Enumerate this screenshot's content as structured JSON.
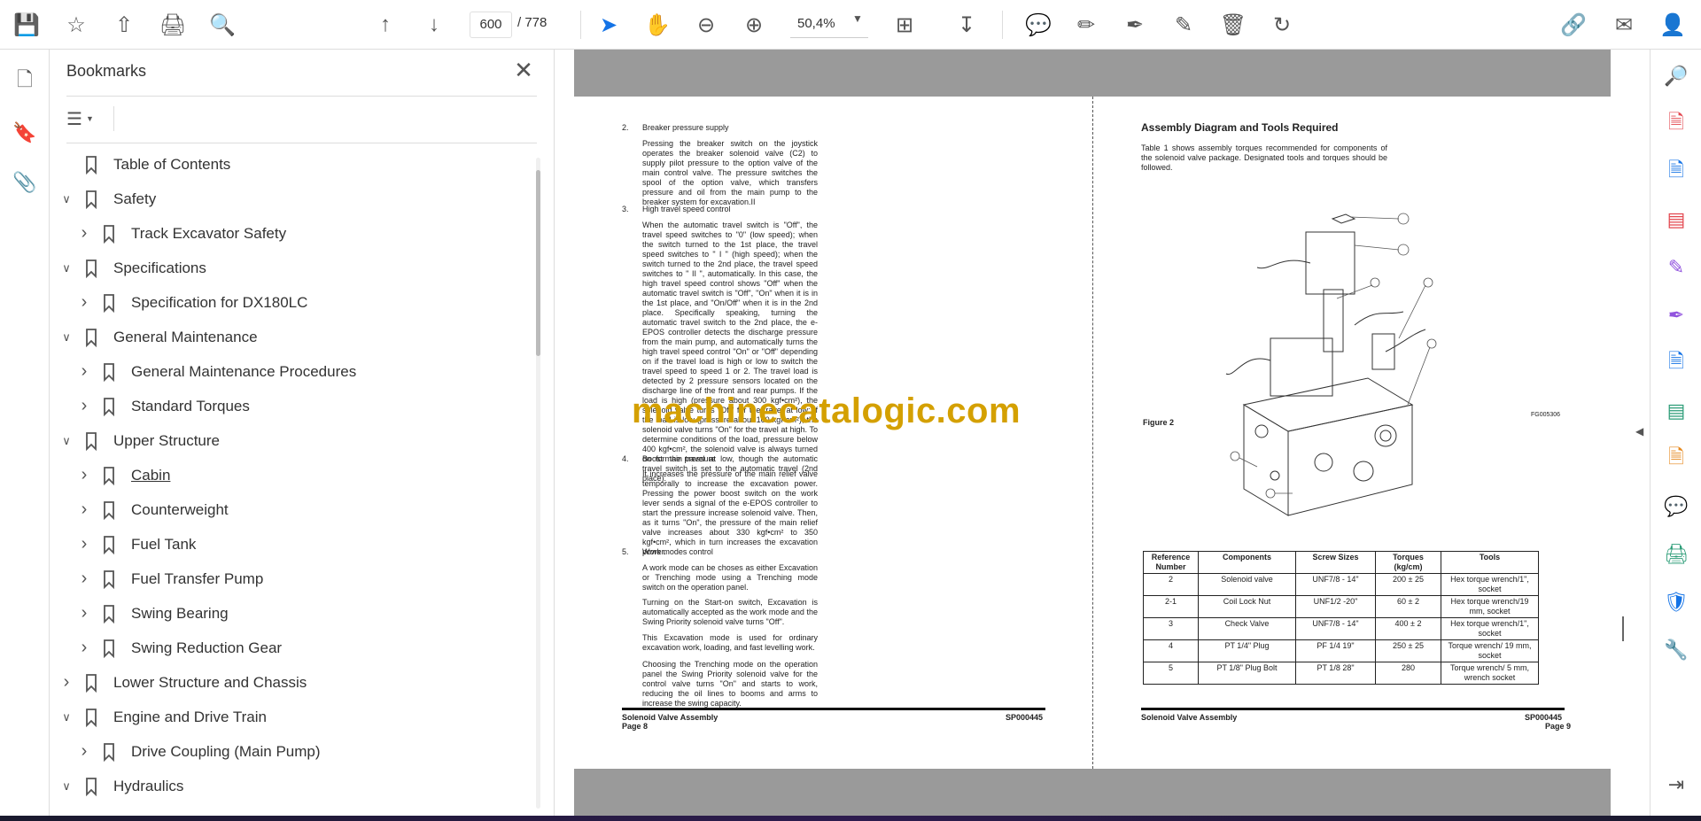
{
  "toolbar": {
    "page_current": "600",
    "page_total": "/ 778",
    "zoom": "50,4%",
    "icons": [
      "save-icon",
      "star-icon",
      "upload-icon",
      "print-icon",
      "find-icon",
      "page-up-icon",
      "page-down-icon",
      "select-arrow-icon",
      "hand-icon",
      "zoom-out-icon",
      "zoom-in-icon",
      "fit-page-icon",
      "scroll-mode-icon",
      "comment-icon",
      "highlight-icon",
      "sign-icon",
      "edit-icon",
      "delete-icon",
      "rotate-icon",
      "share-link-icon",
      "mail-icon",
      "account-icon"
    ]
  },
  "bookmarks": {
    "title": "Bookmarks",
    "items": [
      {
        "label": "Table of Contents",
        "level": 0,
        "chevron": "none"
      },
      {
        "label": "Safety",
        "level": 0,
        "chevron": "down"
      },
      {
        "label": "Track Excavator Safety",
        "level": 1,
        "chevron": "right"
      },
      {
        "label": "Specifications",
        "level": 0,
        "chevron": "down"
      },
      {
        "label": "Specification for DX180LC",
        "level": 1,
        "chevron": "right"
      },
      {
        "label": "General Maintenance",
        "level": 0,
        "chevron": "down"
      },
      {
        "label": "General Maintenance Procedures",
        "level": 1,
        "chevron": "right"
      },
      {
        "label": "Standard Torques",
        "level": 1,
        "chevron": "right"
      },
      {
        "label": "Upper Structure",
        "level": 0,
        "chevron": "down"
      },
      {
        "label": "Cabin",
        "level": 1,
        "chevron": "right"
      },
      {
        "label": "Counterweight",
        "level": 1,
        "chevron": "right"
      },
      {
        "label": "Fuel Tank",
        "level": 1,
        "chevron": "right"
      },
      {
        "label": "Fuel Transfer Pump",
        "level": 1,
        "chevron": "right"
      },
      {
        "label": "Swing Bearing",
        "level": 1,
        "chevron": "right"
      },
      {
        "label": "Swing Reduction Gear",
        "level": 1,
        "chevron": "right"
      },
      {
        "label": "Lower Structure and Chassis",
        "level": 0,
        "chevron": "right"
      },
      {
        "label": "Engine and Drive Train",
        "level": 0,
        "chevron": "down"
      },
      {
        "label": "Drive Coupling (Main Pump)",
        "level": 1,
        "chevron": "right"
      },
      {
        "label": "Hydraulics",
        "level": 0,
        "chevron": "down"
      }
    ]
  },
  "left_page": {
    "s2_num": "2.",
    "s2_title": "Breaker pressure supply",
    "s2_body": "Pressing the breaker switch on the joystick operates the breaker solenoid valve (C2) to supply pilot pressure to the option valve of the main control valve. The pressure switches the spool of the option valve, which transfers pressure and oil from the main pump to the breaker system for excavation.II",
    "s3_num": "3.",
    "s3_title": "High travel speed control",
    "s3_body": "When the automatic travel switch is \"Off\", the travel speed switches to \"0\" (low speed); when the switch turned to the 1st place, the travel speed switches to \" I \" (high speed); when the switch turned to the 2nd place, the travel speed switches to \" II \", automatically. In this case, the high travel speed control shows \"Off\" when the automatic travel switch is \"Off\", \"On\" when it is in the 1st place, and \"On/Off\" when it is in the 2nd place. Specifically speaking, turning the automatic travel switch to the 2nd place, the e-EPOS controller detects the discharge pressure from the main pump, and automatically turns the high travel speed control \"On\" or \"Off\" depending on if the travel load is high or low to switch the travel speed to speed 1 or 2. The travel load is detected by 2 pressure sensors located on the discharge line of the front and rear pumps. If the load is high (pressure about 300 kgf•cm²), the solenoid valve turns \"Off\" for the travel at low; If the load is low (pressure about 160 kgf•cm²), the solenoid valve turns \"On\" for the travel at high. To determine conditions of the load, pressure below 400 kgf•cm², the solenoid valve is always turned on for the travel at low, though the automatic travel switch is set to the automatic travel (2nd place).",
    "s4_num": "4.",
    "s4_title": "Boost main pressure",
    "s4_body": "It increases the pressure of the main relief valve temporally to increase the excavation power. Pressing the power boost switch on the work lever sends a signal of the e-EPOS controller to start the pressure increase solenoid valve. Then, as it turns \"On\", the pressure of the main relief valve increases about 330 kgf•cm² to 350 kgf•cm², which in turn increases the excavation power.",
    "s5_num": "5.",
    "s5_title": "Work modes control",
    "s5_p1": "A work mode can be choses as either Excavation or Trenching mode using a Trenching mode switch on the operation panel.",
    "s5_p2": "Turning on the Start-on switch, Excavation is automatically accepted as the work mode and the Swing Priority solenoid valve turns \"Off\".",
    "s5_p3": "This Excavation mode is used for ordinary excavation work, loading, and fast levelling work.",
    "s5_p4": "Choosing the Trenching mode on the operation panel the Swing Priority solenoid valve for the control valve turns \"On\" and starts to work, reducing the oil lines to booms and arms to increase the swing capacity.",
    "footer_title": "Solenoid Valve Assembly",
    "footer_code": "SP000445",
    "footer_page": "Page 8"
  },
  "right_page": {
    "heading": "Assembly Diagram and Tools Required",
    "intro": "Table 1 shows assembly torques recommended for components of the solenoid valve package. Designated tools and torques should be followed.",
    "figure_label": "Figure 2",
    "figure_code": "FG005306",
    "callouts": [
      "2-1",
      "2-2",
      "2",
      "3",
      "1",
      "4",
      "5"
    ],
    "table": {
      "headers": [
        "Reference Number",
        "Components",
        "Screw Sizes",
        "Torques (kg/cm)",
        "Tools"
      ],
      "rows": [
        [
          "2",
          "Solenoid valve",
          "UNF7/8 - 14\"",
          "200 ± 25",
          "Hex torque wrench/1\", socket"
        ],
        [
          "2-1",
          "Coil Lock Nut",
          "UNF1/2 -20\"",
          "60 ± 2",
          "Hex torque wrench/19 mm, socket"
        ],
        [
          "3",
          "Check Valve",
          "UNF7/8 - 14\"",
          "400 ± 2",
          "Hex torque wrench/1\", socket"
        ],
        [
          "4",
          "PT 1/4\" Plug",
          "PF 1/4 19\"",
          "250 ± 25",
          "Torque wrench/ 19 mm, socket"
        ],
        [
          "5",
          "PT 1/8\" Plug Bolt",
          "PT 1/8 28\"",
          "280",
          "Torque wrench/ 5 mm, wrench socket"
        ]
      ]
    },
    "footer_title": "Solenoid Valve Assembly",
    "footer_code": "SP000445",
    "footer_page": "Page 9"
  },
  "watermark": "machinecatalogic.com",
  "colors": {
    "accent": "#1473e6",
    "watermark": "#d4a000",
    "page_gray": "#9a9a9a"
  }
}
